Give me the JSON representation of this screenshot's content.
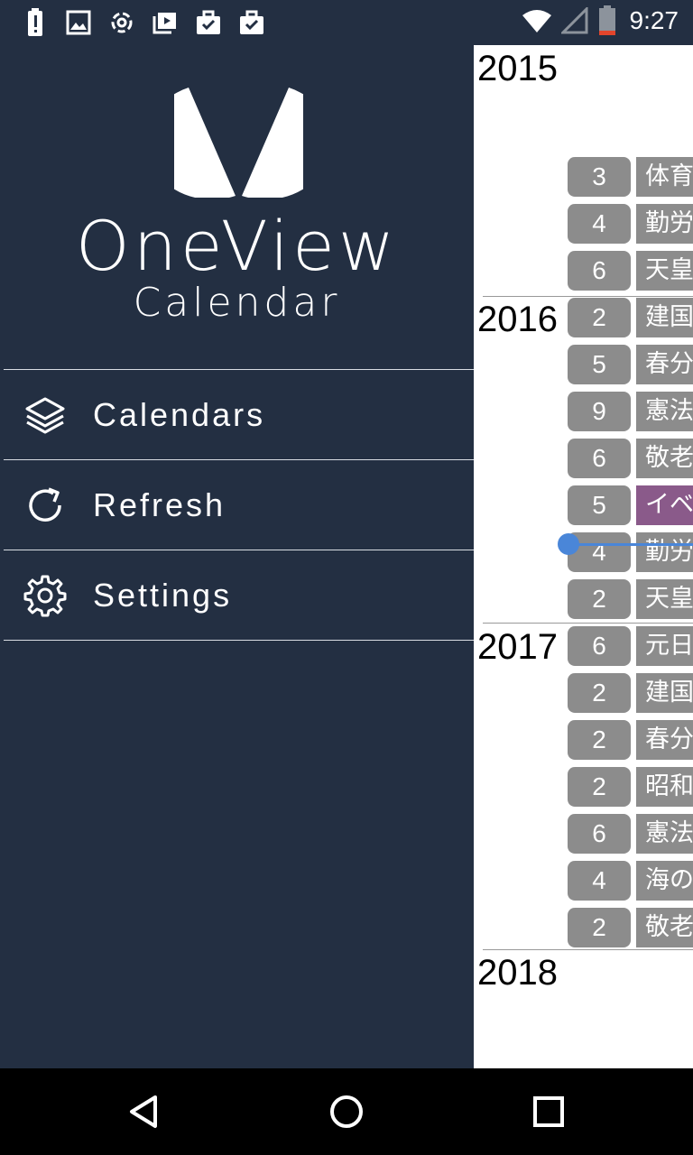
{
  "status_bar": {
    "time": "9:27",
    "left_icons": [
      "battery-alert-icon",
      "image-icon",
      "sync-icon",
      "video-library-icon",
      "briefcase-check-icon",
      "briefcase-check-icon"
    ],
    "right_icons": [
      "wifi-icon",
      "signal-icon",
      "battery-low-icon"
    ]
  },
  "drawer": {
    "brand_line1": "OneView",
    "brand_line2": "Calendar",
    "menu": [
      {
        "label": "Calendars",
        "icon": "layers-icon"
      },
      {
        "label": "Refresh",
        "icon": "refresh-icon"
      },
      {
        "label": "Settings",
        "icon": "gear-icon"
      }
    ]
  },
  "calendar": {
    "years": [
      "2015",
      "2016",
      "2017",
      "2018"
    ],
    "rows": [
      {
        "n": "3",
        "t": "体育"
      },
      {
        "n": "4",
        "t": "勤労"
      },
      {
        "n": "6",
        "t": "天皇"
      },
      {
        "n": "2",
        "t": "建国"
      },
      {
        "n": "5",
        "t": "春分"
      },
      {
        "n": "9",
        "t": "憲法"
      },
      {
        "n": "6",
        "t": "敬老"
      },
      {
        "n": "5",
        "t": "イベ",
        "highlight": true
      },
      {
        "n": "4",
        "t": "勤労"
      },
      {
        "n": "2",
        "t": "天皇"
      },
      {
        "n": "6",
        "t": "元日"
      },
      {
        "n": "2",
        "t": "建国"
      },
      {
        "n": "2",
        "t": "春分"
      },
      {
        "n": "2",
        "t": "昭和"
      },
      {
        "n": "6",
        "t": "憲法"
      },
      {
        "n": "4",
        "t": "海の"
      },
      {
        "n": "2",
        "t": "敬老"
      }
    ],
    "colors": {
      "badge": "#8c8c8c",
      "highlight": "#8a5a8a",
      "now_line": "#4a86d8"
    }
  },
  "navbar": {
    "icons": [
      "back-icon",
      "home-icon",
      "recents-icon"
    ]
  }
}
